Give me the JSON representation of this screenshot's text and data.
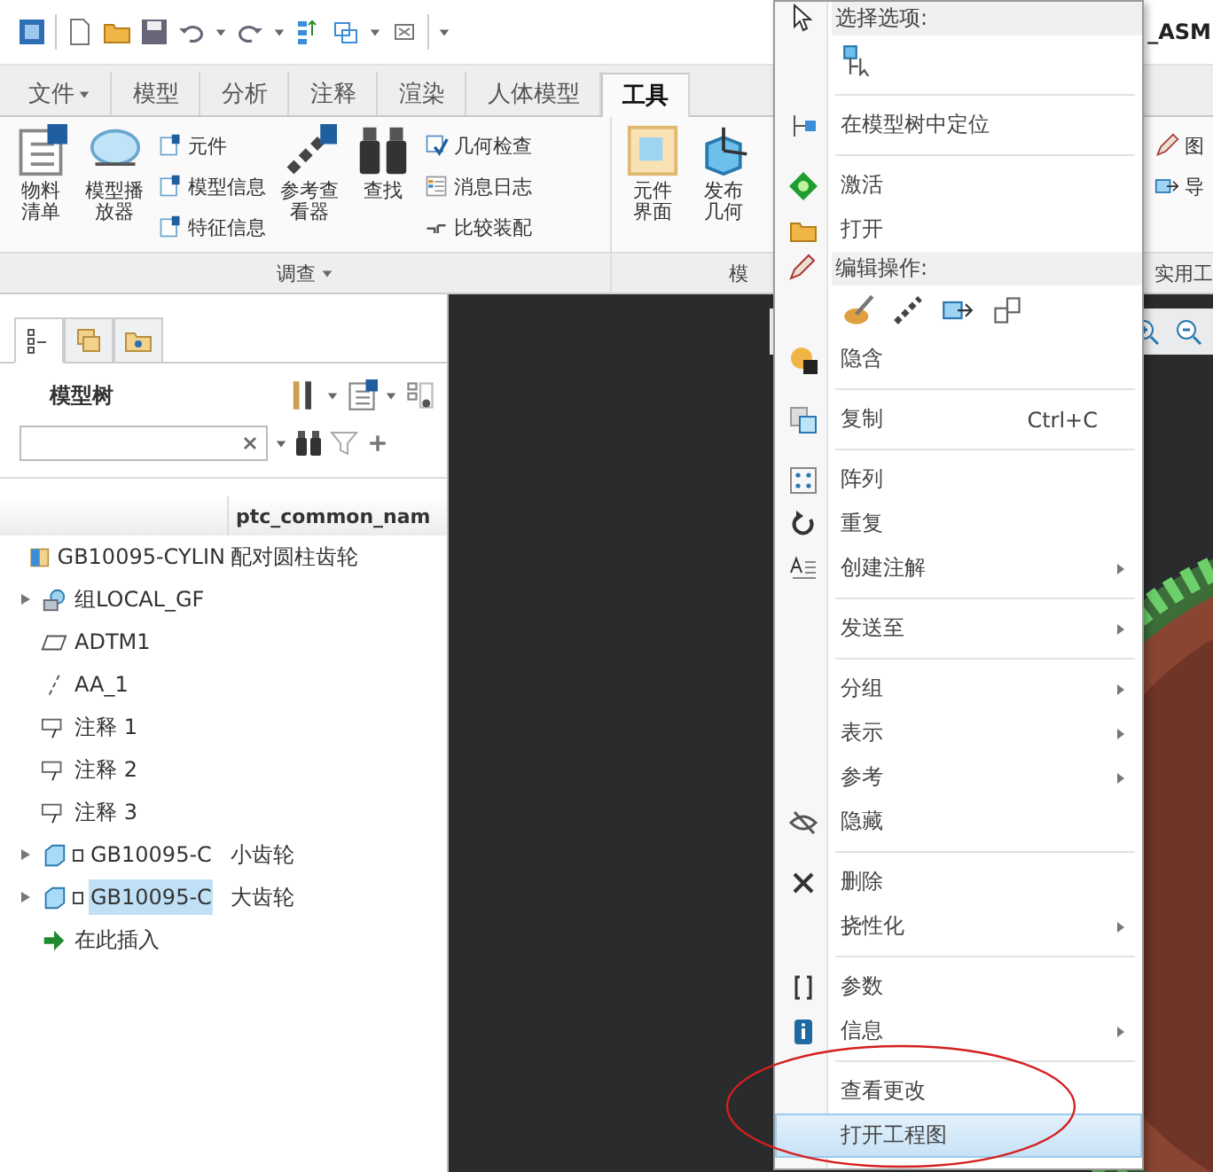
{
  "title": "_ASM",
  "ribbon_tabs": [
    {
      "label": "文件",
      "dropdown": true,
      "selected": false
    },
    {
      "label": "模型",
      "dropdown": false,
      "selected": false
    },
    {
      "label": "分析",
      "dropdown": false,
      "selected": false
    },
    {
      "label": "注释",
      "dropdown": false,
      "selected": false
    },
    {
      "label": "渲染",
      "dropdown": false,
      "selected": false
    },
    {
      "label": "人体模型",
      "dropdown": false,
      "selected": false
    },
    {
      "label": "工具",
      "dropdown": false,
      "selected": true
    }
  ],
  "ribbon_groups": [
    {
      "label": "调查",
      "dropdown": true,
      "items": [
        {
          "kind": "large",
          "label": "物料清单"
        },
        {
          "kind": "large",
          "label": "模型播放器"
        },
        {
          "kind": "stack",
          "labels": [
            "元件",
            "模型信息",
            "特征信息"
          ]
        },
        {
          "kind": "large",
          "label": "参考查看器"
        },
        {
          "kind": "large",
          "label": "查找"
        },
        {
          "kind": "stack",
          "labels": [
            "几何检查",
            "消息日志",
            "比较装配"
          ]
        }
      ]
    },
    {
      "label": "模",
      "items": [
        {
          "kind": "large",
          "label": "元件界面"
        },
        {
          "kind": "large",
          "label": "发布几何"
        }
      ]
    },
    {
      "label": "实用工",
      "items": [
        {
          "kind": "stack",
          "labels": [
            "图",
            "导"
          ]
        }
      ]
    }
  ],
  "panel_tabs": [
    {
      "selected": true
    },
    {
      "selected": false
    },
    {
      "selected": false
    }
  ],
  "model_tree": {
    "title": "模型树",
    "name_column": "ptc_common_nam",
    "rows": [
      {
        "kind": "assembly",
        "label": "GB10095-CYLIN",
        "common_name": "配对圆柱齿轮",
        "selected": false,
        "children": [
          {
            "kind": "group",
            "label": "组LOCAL_GF",
            "expanded": false,
            "selected": false
          },
          {
            "kind": "datum_plane",
            "label": "ADTM1",
            "selected": false
          },
          {
            "kind": "axis",
            "label": "AA_1",
            "selected": false
          },
          {
            "kind": "note",
            "label": "注释 1",
            "selected": false
          },
          {
            "kind": "note",
            "label": "注释 2",
            "selected": false
          },
          {
            "kind": "note",
            "label": "注释 3",
            "selected": false
          },
          {
            "kind": "part",
            "label": "GB10095-C",
            "common_name": "小齿轮",
            "expanded": false,
            "selected": false
          },
          {
            "kind": "part",
            "label": "GB10095-C",
            "common_name": "大齿轮",
            "expanded": false,
            "selected": true
          },
          {
            "kind": "insert",
            "label": "在此插入",
            "selected": false
          }
        ]
      }
    ]
  },
  "context_menu": [
    {
      "kind": "header",
      "label": "选择选项:"
    },
    {
      "kind": "icon_row"
    },
    {
      "kind": "separator"
    },
    {
      "kind": "item",
      "label": "在模型树中定位",
      "submenu": false,
      "selected": false
    },
    {
      "kind": "separator"
    },
    {
      "kind": "item",
      "label": "激活",
      "submenu": false,
      "selected": false
    },
    {
      "kind": "item",
      "label": "打开",
      "submenu": false,
      "selected": false
    },
    {
      "kind": "header",
      "label": "编辑操作:"
    },
    {
      "kind": "icon_row"
    },
    {
      "kind": "item",
      "label": "隐含",
      "submenu": false,
      "selected": false
    },
    {
      "kind": "separator"
    },
    {
      "kind": "item",
      "label": "复制",
      "shortcut": "Ctrl+C",
      "submenu": false,
      "selected": false
    },
    {
      "kind": "separator"
    },
    {
      "kind": "item",
      "label": "阵列",
      "submenu": false,
      "selected": false
    },
    {
      "kind": "item",
      "label": "重复",
      "submenu": false,
      "selected": false
    },
    {
      "kind": "item",
      "label": "创建注解",
      "submenu": true,
      "selected": false
    },
    {
      "kind": "separator"
    },
    {
      "kind": "item",
      "label": "发送至",
      "submenu": true,
      "selected": false
    },
    {
      "kind": "separator"
    },
    {
      "kind": "item",
      "label": "分组",
      "submenu": true,
      "selected": false
    },
    {
      "kind": "item",
      "label": "表示",
      "submenu": true,
      "selected": false
    },
    {
      "kind": "item",
      "label": "参考",
      "submenu": true,
      "selected": false
    },
    {
      "kind": "item",
      "label": "隐藏",
      "submenu": false,
      "selected": false
    },
    {
      "kind": "separator"
    },
    {
      "kind": "item",
      "label": "删除",
      "submenu": false,
      "selected": false
    },
    {
      "kind": "item",
      "label": "挠性化",
      "submenu": true,
      "selected": false
    },
    {
      "kind": "separator"
    },
    {
      "kind": "item",
      "label": "参数",
      "submenu": false,
      "selected": false
    },
    {
      "kind": "item",
      "label": "信息",
      "submenu": true,
      "selected": false
    },
    {
      "kind": "separator"
    },
    {
      "kind": "item",
      "label": "查看更改",
      "submenu": false,
      "selected": false
    },
    {
      "kind": "item",
      "label": "打开工程图",
      "submenu": false,
      "selected": true
    }
  ]
}
